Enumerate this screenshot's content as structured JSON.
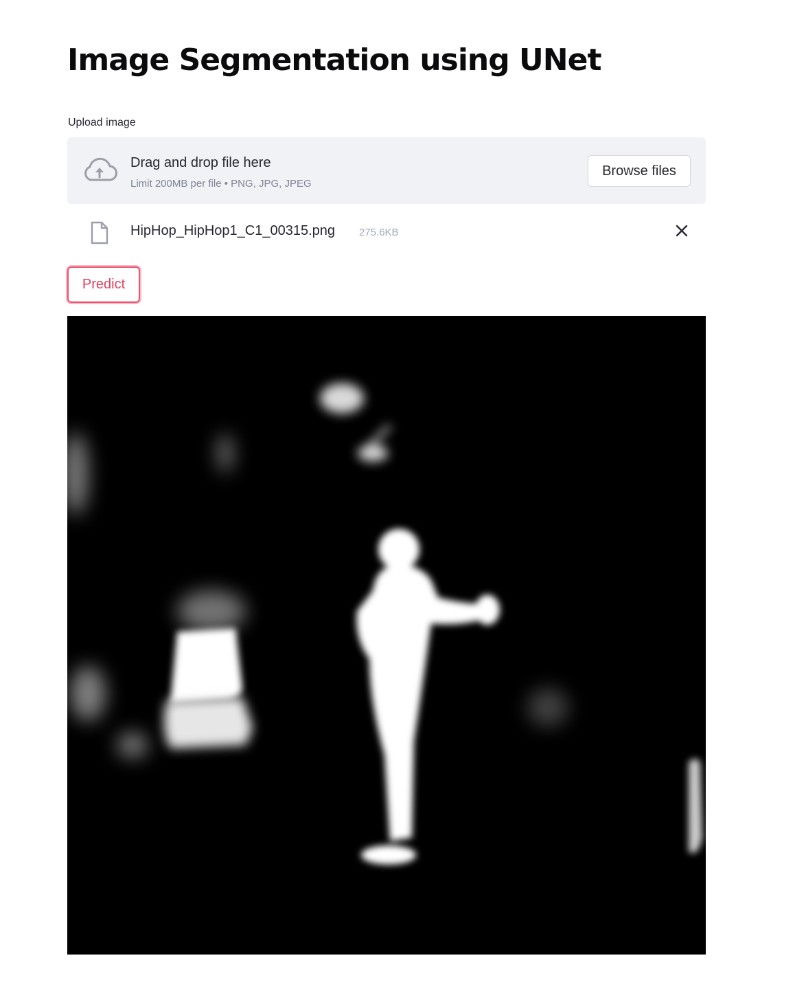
{
  "page": {
    "title": "Image Segmentation using UNet"
  },
  "uploader": {
    "label": "Upload image",
    "dropzone_title": "Drag and drop file here",
    "dropzone_subtitle": "Limit 200MB per file • PNG, JPG, JPEG",
    "browse_label": "Browse files",
    "upload_icon": "cloud-upload-icon"
  },
  "uploaded_file": {
    "name": "HipHop_HipHop1_C1_00315.png",
    "size": "275.6KB",
    "file_icon": "file-icon",
    "remove_icon": "close-icon"
  },
  "actions": {
    "predict_label": "Predict"
  },
  "result": {
    "description": "segmentation-mask-output"
  },
  "colors": {
    "accent": "#e24160",
    "dropzone_bg": "#f0f2f6",
    "text": "#262730",
    "muted": "#808495"
  }
}
